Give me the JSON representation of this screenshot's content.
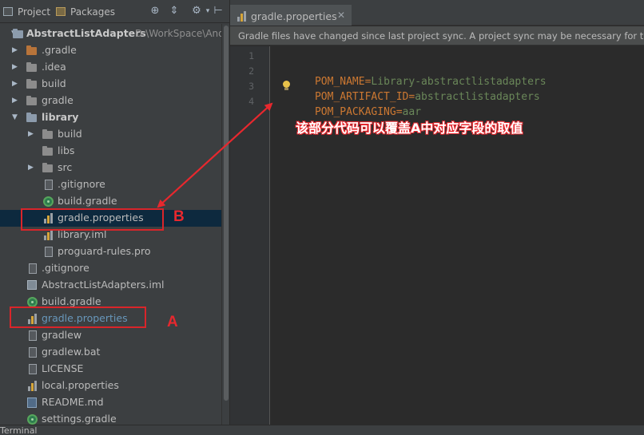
{
  "toolbar": {
    "project_label": "Project",
    "packages_label": "Packages",
    "settings_icon": "gear-icon",
    "scroll_icon": "target-icon",
    "split_icon": "split-icon"
  },
  "tree": {
    "root_label": "AbstractListAdapters",
    "root_path": "D:\\WorkSpace\\Andr",
    "items": [
      {
        "label": ".gradle",
        "icon": "folder-orange-icon",
        "expand": "collapsed"
      },
      {
        "label": ".idea",
        "icon": "folder-icon",
        "expand": "collapsed"
      },
      {
        "label": "build",
        "icon": "folder-icon",
        "expand": "collapsed"
      },
      {
        "label": "gradle",
        "icon": "folder-icon",
        "expand": "collapsed"
      },
      {
        "label": "library",
        "icon": "module-folder-icon",
        "expand": "expanded"
      },
      {
        "label": "build",
        "icon": "folder-icon",
        "expand": "collapsed"
      },
      {
        "label": "libs",
        "icon": "folder-icon",
        "expand": "none"
      },
      {
        "label": "src",
        "icon": "folder-icon",
        "expand": "collapsed"
      },
      {
        "label": ".gitignore",
        "icon": "text-file-icon",
        "expand": "none"
      },
      {
        "label": "build.gradle",
        "icon": "gradle-icon",
        "expand": "none"
      },
      {
        "label": "gradle.properties",
        "icon": "properties-file-icon",
        "expand": "none"
      },
      {
        "label": "library.iml",
        "icon": "properties-file-icon",
        "expand": "none"
      },
      {
        "label": "proguard-rules.pro",
        "icon": "text-file-icon",
        "expand": "none"
      },
      {
        "label": ".gitignore",
        "icon": "text-file-icon",
        "expand": "none"
      },
      {
        "label": "AbstractListAdapters.iml",
        "icon": "iml-file-icon",
        "expand": "none"
      },
      {
        "label": "build.gradle",
        "icon": "gradle-icon",
        "expand": "none"
      },
      {
        "label": "gradle.properties",
        "icon": "properties-file-icon",
        "expand": "none"
      },
      {
        "label": "gradlew",
        "icon": "text-file-icon",
        "expand": "none"
      },
      {
        "label": "gradlew.bat",
        "icon": "text-file-icon",
        "expand": "none"
      },
      {
        "label": "LICENSE",
        "icon": "text-file-icon",
        "expand": "none"
      },
      {
        "label": "local.properties",
        "icon": "properties-file-icon",
        "expand": "none"
      },
      {
        "label": "README.md",
        "icon": "markdown-file-icon",
        "expand": "none"
      },
      {
        "label": "settings.gradle",
        "icon": "gradle-icon",
        "expand": "none"
      }
    ]
  },
  "editor": {
    "tab_label": "gradle.properties",
    "notification": "Gradle files have changed since last project sync. A project sync may be necessary for t",
    "line_numbers": [
      "1",
      "2",
      "3",
      "4"
    ],
    "lines": [
      {
        "key": "",
        "value": ""
      },
      {
        "key": "POM_NAME=",
        "value": "Library-abstractlistadapters"
      },
      {
        "key": "POM_ARTIFACT_ID=",
        "value": "abstractlistadapters"
      },
      {
        "key": "POM_PACKAGING=",
        "value": "aar"
      }
    ]
  },
  "annotations": {
    "label_a": "A",
    "label_b": "B",
    "note": "该部分代码可以覆盖A中对应字段的取值",
    "color": "#e7282e"
  },
  "bottom": {
    "terminal_label": "Terminal"
  },
  "colors": {
    "panel_bg": "#3c3f41",
    "editor_bg": "#2b2b2b",
    "selection_bg": "#0d293e",
    "property_key": "#cc7832",
    "property_value": "#6a8759"
  }
}
